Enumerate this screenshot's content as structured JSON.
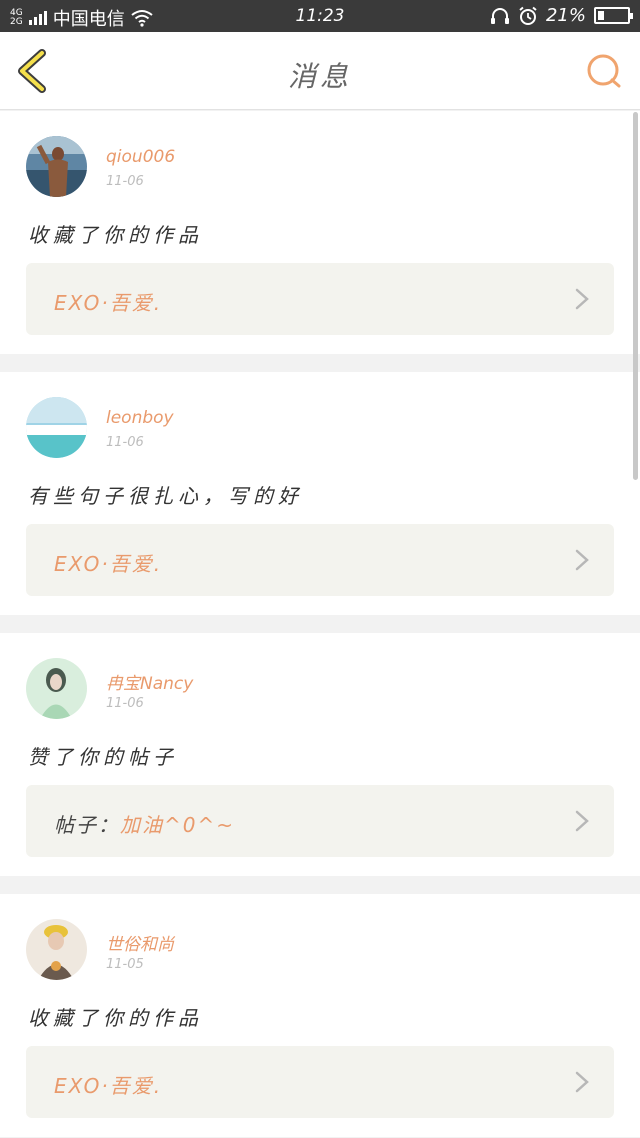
{
  "status_bar": {
    "network_top": "4G",
    "network_bottom": "2G",
    "carrier": "中国电信",
    "time": "11:23",
    "battery": "21%",
    "battery_level": 0.21
  },
  "nav": {
    "title": "消息",
    "accent_color": "#f0a46e"
  },
  "notifications": [
    {
      "username": "qiou006",
      "date": "11-06",
      "message": "收藏了你的作品",
      "ref_prefix": "",
      "ref_text": "EXO·吾爱."
    },
    {
      "username": "leonboy",
      "date": "11-06",
      "message": "有些句子很扎心，写的好",
      "ref_prefix": "",
      "ref_text": "EXO·吾爱."
    },
    {
      "username": "冉宝Nancy",
      "date": "11-06",
      "message": "赞了你的帖子",
      "ref_prefix": "帖子：",
      "ref_text": "加油^0^~"
    },
    {
      "username": "世俗和尚",
      "date": "11-05",
      "message": "收藏了你的作品",
      "ref_prefix": "",
      "ref_text": "EXO·吾爱."
    }
  ]
}
